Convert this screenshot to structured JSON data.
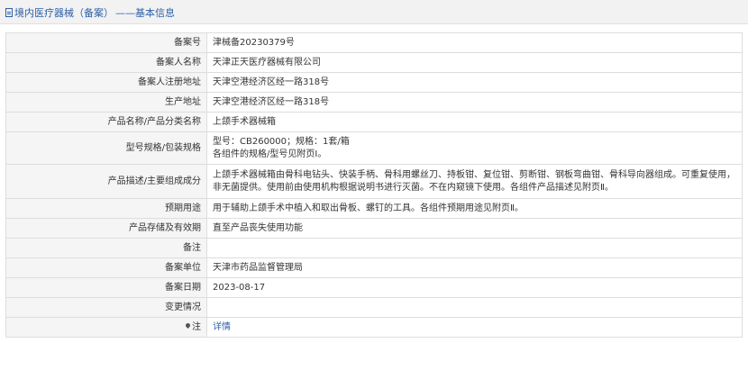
{
  "header": {
    "title": "境内医疗器械（备案）",
    "subtitle": "——基本信息"
  },
  "rows": [
    {
      "label": "备案号",
      "value": "津械备20230379号"
    },
    {
      "label": "备案人名称",
      "value": "天津正天医疗器械有限公司"
    },
    {
      "label": "备案人注册地址",
      "value": "天津空港经济区经一路318号"
    },
    {
      "label": "生产地址",
      "value": "天津空港经济区经一路318号"
    },
    {
      "label": "产品名称/产品分类名称",
      "value": "上颌手术器械箱"
    },
    {
      "label": "型号规格/包装规格",
      "value_line1": "型号：CB260000；规格：1套/箱",
      "value_line2": "各组件的规格/型号见附页Ⅰ。"
    },
    {
      "label": "产品描述/主要组成成分",
      "value_line1": "上颌手术器械箱由骨科电钻头、快装手柄、骨科用螺丝刀、持板钳、复位钳、剪断钳、钢板弯曲钳、骨科导向器组成。可重复使用，",
      "value_line2": "非无菌提供。使用前由使用机构根据说明书进行灭菌。不在内窥镜下使用。各组件产品描述见附页Ⅱ。"
    },
    {
      "label": "预期用途",
      "value": "用于辅助上颌手术中植入和取出骨板、螺钉的工具。各组件预期用途见附页Ⅱ。"
    },
    {
      "label": "产品存储及有效期",
      "value": "直至产品丧失使用功能"
    },
    {
      "label": "备注",
      "value": ""
    },
    {
      "label": "备案单位",
      "value": "天津市药品监督管理局"
    },
    {
      "label": "备案日期",
      "value": "2023-08-17"
    },
    {
      "label": "变更情况",
      "value": ""
    },
    {
      "label": "注",
      "value": "详情",
      "icon": "pin-icon"
    }
  ]
}
